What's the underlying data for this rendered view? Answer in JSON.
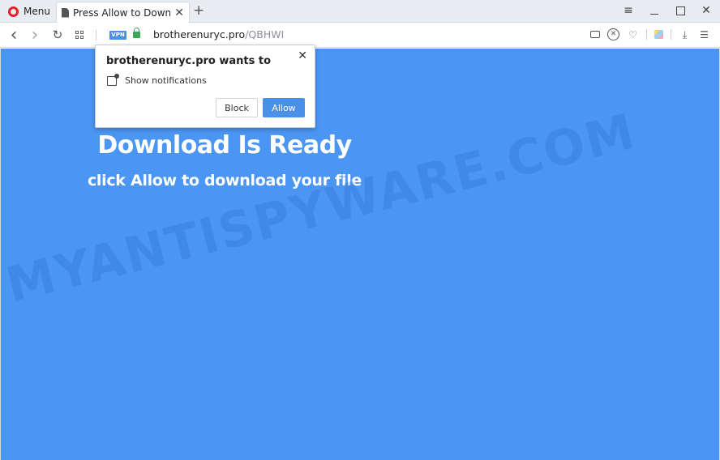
{
  "tabbar": {
    "menu_label": "Menu",
    "active_tab_title": "Press Allow to Download",
    "tab_close_glyph": "✕",
    "new_tab_glyph": "+"
  },
  "window_controls": {
    "menu_glyph": "≡",
    "close_glyph": "✕"
  },
  "navbar": {
    "back_glyph": "‹",
    "forward_glyph": "›",
    "reload_glyph": "↻",
    "vpn_label": "VPN",
    "url_domain": "brotherenuryc.pro",
    "url_path": "/QBHWI",
    "icons": [
      "snapshot-icon",
      "adblock-icon",
      "heart-icon",
      "extension-cube-icon",
      "download-icon",
      "easy-setup-icon"
    ],
    "heart_glyph": "♡",
    "download_glyph": "⤓",
    "settings_glyph": "☰"
  },
  "page": {
    "headline": "Download Is Ready",
    "subline": "click Allow to download your file",
    "watermark": "MYANTISPYWARE.COM",
    "background_color": "#4b96f3"
  },
  "popup": {
    "title": "brotherenuryc.pro wants to",
    "close_glyph": "✕",
    "permission_label": "Show notifications",
    "block_label": "Block",
    "allow_label": "Allow",
    "allow_color": "#4a8fe8"
  }
}
